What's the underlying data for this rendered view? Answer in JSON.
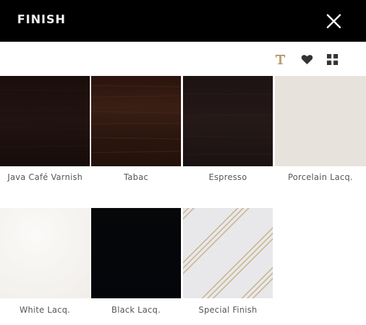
{
  "header": {
    "title": "FINISH",
    "close_icon": "close-icon"
  },
  "toolbar": {
    "text_icon": "text-t-icon",
    "heart_icon": "heart-icon",
    "grid_icon": "grid-view-icon",
    "text_icon_color": "#b89a6e",
    "icon_color": "#333333"
  },
  "finishes": [
    {
      "name": "Java Café Varnish",
      "color": "#1a0f0c"
    },
    {
      "name": "Tabac",
      "color": "#2b160f"
    },
    {
      "name": "Espresso",
      "color": "#1e1514"
    },
    {
      "name": "Porcelain Lacq.",
      "color": "#e7e3dc"
    },
    {
      "name": "White Lacq.",
      "color": "#f7f5f2"
    },
    {
      "name": "Black Lacq.",
      "color": "#050709"
    },
    {
      "name": "Special Finish",
      "color": "#e8e8ea",
      "stripe_color": "#c9b48f"
    }
  ]
}
